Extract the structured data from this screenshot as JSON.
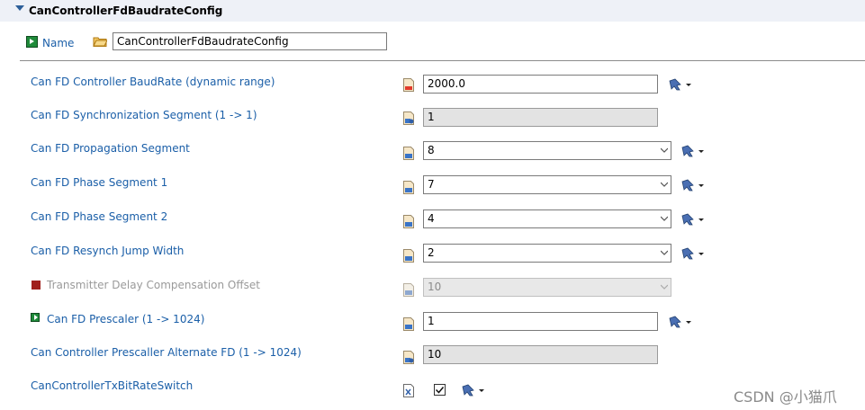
{
  "section": {
    "title": "CanControllerFdBaudrateConfig"
  },
  "name_row": {
    "label": "Name",
    "value": "CanControllerFdBaudrateConfig"
  },
  "rows": [
    {
      "label": "Can FD Controller BaudRate (dynamic range)",
      "value": "2000.0",
      "type": "text"
    },
    {
      "label": "Can FD Synchronization Segment (1 -> 1)",
      "value": "1",
      "type": "readonly"
    },
    {
      "label": "Can FD Propagation Segment",
      "value": "8",
      "type": "combo"
    },
    {
      "label": "Can FD Phase Segment 1",
      "value": "7",
      "type": "combo"
    },
    {
      "label": "Can FD Phase Segment 2",
      "value": "4",
      "type": "combo"
    },
    {
      "label": "Can FD Resynch Jump Width",
      "value": "2",
      "type": "combo"
    },
    {
      "label": "Transmitter Delay Compensation Offset",
      "value": "10",
      "type": "disabled-combo"
    },
    {
      "label": "Can FD Prescaler (1 -> 1024)",
      "value": "1",
      "type": "text"
    },
    {
      "label": "Can Controller Prescaller Alternate FD (1 -> 1024)",
      "value": "10",
      "type": "readonly"
    },
    {
      "label": "CanControllerTxBitRateSwitch",
      "value": "true",
      "type": "checkbox"
    }
  ],
  "watermark": "CSDN @小猫爪",
  "colors": {
    "label": "#1b5fa8",
    "header_bg": "#eef1f7",
    "disabled": "#9a9a9a"
  }
}
